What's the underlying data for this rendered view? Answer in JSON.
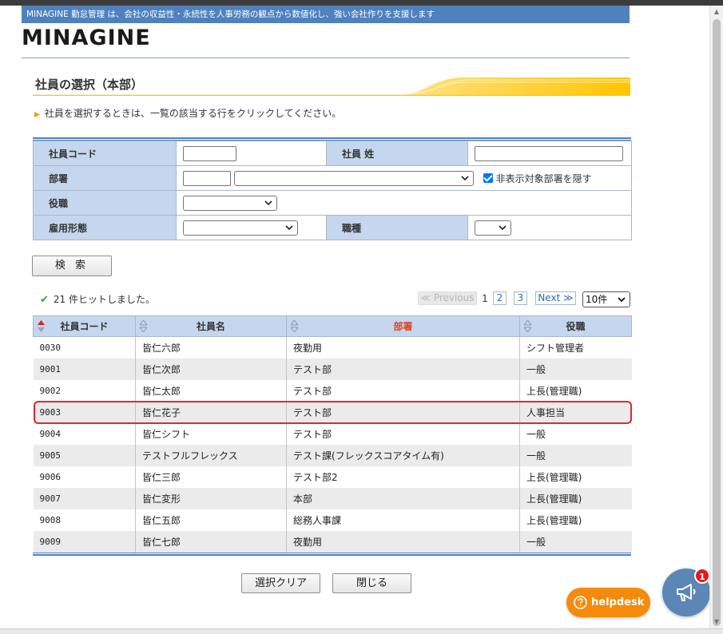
{
  "header": {
    "banner_text": "MINAGINE 勤怠管理 は、会社の収益性・永続性を人事労務の観点から数値化し、強い会社作りを支援します",
    "logo_text": "MINAGINE"
  },
  "page": {
    "title": "社員の選択（本部）",
    "instruction": "社員を選択するときは、一覧の該当する行をクリックしてください。"
  },
  "form": {
    "employee_code_label": "社員コード",
    "last_name_label": "社員 姓",
    "department_label": "部署",
    "hide_departments_label": "非表示対象部署を隠す",
    "hide_departments_checked": true,
    "position_label": "役職",
    "employment_type_label": "雇用形態",
    "job_type_label": "職種",
    "search_button": "検 索"
  },
  "results_info": {
    "hit_text": "21 件ヒットしました。",
    "pager": {
      "previous": "≪ Previous",
      "current": "1",
      "page2": "2",
      "page3": "3",
      "next": "Next ≫",
      "page_size": "10件"
    }
  },
  "table": {
    "headers": [
      "社員コード",
      "社員名",
      "部署",
      "役職"
    ],
    "sorted_column": "社員コード",
    "highlight_header_color": "#e0441e",
    "rows": [
      {
        "code": "0030",
        "name": "皆仁六郎",
        "dept": "夜勤用",
        "position": "シフト管理者"
      },
      {
        "code": "9001",
        "name": "皆仁次郎",
        "dept": "テスト部",
        "position": "一般"
      },
      {
        "code": "9002",
        "name": "皆仁太郎",
        "dept": "テスト部",
        "position": "上長(管理職)"
      },
      {
        "code": "9003",
        "name": "皆仁花子",
        "dept": "テスト部",
        "position": "人事担当"
      },
      {
        "code": "9004",
        "name": "皆仁シフト",
        "dept": "テスト部",
        "position": "一般"
      },
      {
        "code": "9005",
        "name": "テストフルフレックス",
        "dept": "テスト課(フレックスコアタイム有)",
        "position": "一般"
      },
      {
        "code": "9006",
        "name": "皆仁三郎",
        "dept": "テスト部2",
        "position": "上長(管理職)"
      },
      {
        "code": "9007",
        "name": "皆仁変形",
        "dept": "本部",
        "position": "上長(管理職)"
      },
      {
        "code": "9008",
        "name": "皆仁五郎",
        "dept": "総務人事課",
        "position": "上長(管理職)"
      },
      {
        "code": "9009",
        "name": "皆仁七郎",
        "dept": "夜勤用",
        "position": "一般"
      }
    ]
  },
  "footer": {
    "clear_button": "選択クリア",
    "close_button": "閉じる"
  },
  "widgets": {
    "helpdesk_label": "helpdesk",
    "notification_count": "1",
    "brand_color": "#4f81bd",
    "helpdesk_color": "#f58a0b"
  }
}
